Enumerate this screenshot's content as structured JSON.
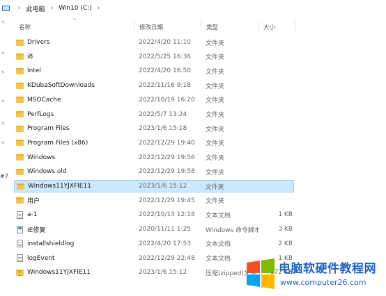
{
  "breadcrumb": {
    "sep": "›",
    "items": [
      "此电脑",
      "Win10 (C:)"
    ]
  },
  "sidebar": {
    "label": "#7"
  },
  "header": {
    "name": "名称",
    "date": "修改日期",
    "type": "类型",
    "size": "大小",
    "sort_arrow": "^"
  },
  "files": [
    {
      "icon": "folder-icon",
      "name": "Drivers",
      "date": "2022/4/20 11:10",
      "type": "文件夹",
      "size": ""
    },
    {
      "icon": "folder-icon",
      "name": "i8",
      "date": "2022/5/25 16:36",
      "type": "文件夹",
      "size": ""
    },
    {
      "icon": "folder-icon",
      "name": "Intel",
      "date": "2022/4/20 16:50",
      "type": "文件夹",
      "size": ""
    },
    {
      "icon": "folder-icon",
      "name": "KDubaSoftDownloads",
      "date": "2022/11/16 9:18",
      "type": "文件夹",
      "size": ""
    },
    {
      "icon": "folder-icon",
      "name": "MSOCache",
      "date": "2022/10/19 16:20",
      "type": "文件夹",
      "size": ""
    },
    {
      "icon": "folder-icon",
      "name": "PerfLogs",
      "date": "2022/5/7 13:24",
      "type": "文件夹",
      "size": ""
    },
    {
      "icon": "folder-icon",
      "name": "Program Files",
      "date": "2023/1/6 15:18",
      "type": "文件夹",
      "size": ""
    },
    {
      "icon": "folder-icon",
      "name": "Program Files (x86)",
      "date": "2022/12/29 19:40",
      "type": "文件夹",
      "size": ""
    },
    {
      "icon": "folder-icon",
      "name": "Windows",
      "date": "2022/12/29 19:56",
      "type": "文件夹",
      "size": ""
    },
    {
      "icon": "folder-icon",
      "name": "Windows.old",
      "date": "2022/12/29 19:58",
      "type": "文件夹",
      "size": ""
    },
    {
      "icon": "folder-icon",
      "name": "Windows11YJXFIE11",
      "date": "2023/1/6 15:12",
      "type": "文件夹",
      "size": "",
      "selected": true
    },
    {
      "icon": "folder-icon",
      "name": "用户",
      "date": "2022/12/29 19:45",
      "type": "文件夹",
      "size": ""
    },
    {
      "icon": "text-file-icon",
      "name": "a-1",
      "date": "2022/10/13 12:18",
      "type": "文本文档",
      "size": "1 KB"
    },
    {
      "icon": "script-file-icon",
      "name": "IE修复",
      "date": "2020/11/11 1:25",
      "type": "Windows 命令脚本",
      "size": "3 KB"
    },
    {
      "icon": "text-file-icon",
      "name": "installshieldlog",
      "date": "2022/4/20 17:53",
      "type": "文本文档",
      "size": "2 KB"
    },
    {
      "icon": "text-file-icon",
      "name": "logEvent",
      "date": "2022/12/29 22:48",
      "type": "文本文档",
      "size": "1 KB"
    },
    {
      "icon": "zip-folder-icon",
      "name": "Windows11YJXFIE11",
      "date": "2023/1/6 15:12",
      "type": "压缩(zipped)文件",
      "size": "172 KB"
    }
  ],
  "watermark": {
    "title": "电脑软硬件教程网",
    "url": "www.computer26.com",
    "colors": [
      "#f25022",
      "#7fba00",
      "#00a4ef",
      "#ffb900"
    ]
  }
}
